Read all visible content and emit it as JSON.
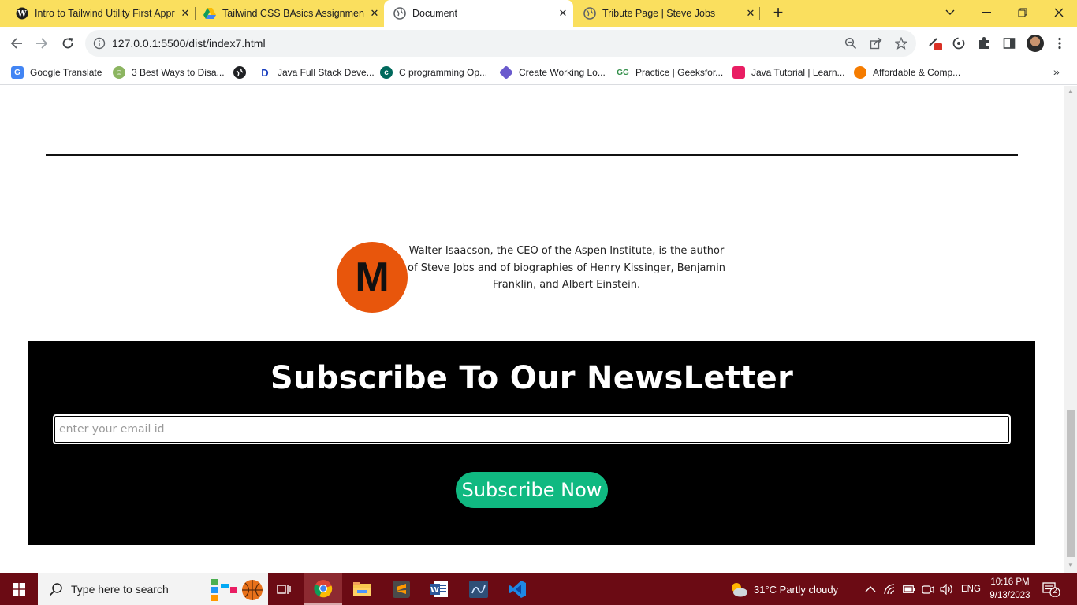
{
  "browser": {
    "tabs": [
      {
        "title": "Intro to Tailwind Utility First Approach",
        "icon": "wordpress-icon",
        "active": false
      },
      {
        "title": "Tailwind CSS BAsics Assignment",
        "icon": "google-drive-icon",
        "active": false
      },
      {
        "title": "Document",
        "icon": "globe-icon",
        "active": true
      },
      {
        "title": "Tribute Page | Steve Jobs",
        "icon": "globe-icon",
        "active": false
      }
    ],
    "new_tab_label": "+",
    "address": "127.0.0.1:5500/dist/index7.html",
    "bookmarks": [
      {
        "label": "Google Translate",
        "icon": "google-translate-icon",
        "color": "#4285f4"
      },
      {
        "label": "3 Best Ways to Disa...",
        "icon": "wikihow-icon",
        "color": "#8cb561"
      },
      {
        "label": "",
        "icon": "globe-icon",
        "color": "#202124"
      },
      {
        "label": "Java Full Stack Deve...",
        "icon": "dev-icon",
        "color": "#1a3fbf"
      },
      {
        "label": "C programming Op...",
        "icon": "c-icon",
        "color": "#00695c"
      },
      {
        "label": "Create Working Lo...",
        "icon": "hex-icon",
        "color": "#6a5acd"
      },
      {
        "label": "Practice | Geeksfor...",
        "icon": "geeksforgeeks-icon",
        "color": "#2f8d46"
      },
      {
        "label": "Java Tutorial | Learn...",
        "icon": "cube-icon",
        "color": "#e91e63"
      },
      {
        "label": "Affordable & Comp...",
        "icon": "orange-circle-icon",
        "color": "#f57c00"
      }
    ]
  },
  "page": {
    "author": {
      "logo_letter": "M",
      "bio": "Walter Isaacson, the CEO of the Aspen Institute, is the author of Steve Jobs and of biographies of Henry Kissinger, Benjamin Franklin, and Albert Einstein."
    },
    "newsletter": {
      "title": "Subscribe To Our NewsLetter",
      "email_placeholder": "enter your email id",
      "button_label": "Subscribe Now"
    }
  },
  "taskbar": {
    "search_placeholder": "Type here to search",
    "weather": "31°C  Partly cloudy",
    "language": "ENG",
    "time": "10:16 PM",
    "date": "9/13/2023",
    "notification_count": "2"
  },
  "colors": {
    "tabstrip": "#fadf5e",
    "taskbar": "#6b0b14",
    "logo_circle": "#e8560c",
    "subscribe_button": "#10b981",
    "newsletter_bg": "#000000"
  }
}
